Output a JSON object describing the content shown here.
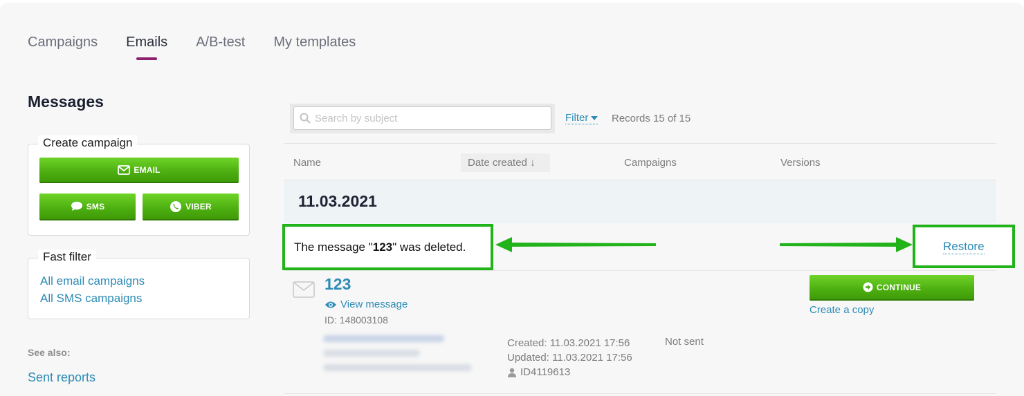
{
  "tabs": [
    "Campaigns",
    "Emails",
    "A/B-test",
    "My templates"
  ],
  "active_tab": "Emails",
  "sidebar": {
    "title": "Messages",
    "create_campaign": {
      "legend": "Create campaign",
      "email_label": "EMAIL",
      "sms_label": "SMS",
      "viber_label": "VIBER"
    },
    "fast_filter": {
      "legend": "Fast filter",
      "links": [
        "All email campaigns",
        "All SMS campaigns"
      ]
    },
    "see_also_label": "See also:",
    "sent_reports_label": "Sent reports"
  },
  "toolbar": {
    "search_placeholder": "Search by subject",
    "filter_label": "Filter",
    "records_text": "Records 15 of 15"
  },
  "table": {
    "headers": [
      "Name",
      "Date created",
      "Campaigns",
      "Versions"
    ],
    "date_created_sort_glyph": "↓",
    "date_group": "11.03.2021"
  },
  "notification": {
    "prefix": "The message \"",
    "name": "123",
    "suffix": "\" was deleted.",
    "restore_label": "Restore"
  },
  "message": {
    "title": "123",
    "view_label": "View message",
    "id_text": "ID: 148003108",
    "created": "Created: 11.03.2021 17:56",
    "updated": "Updated: 11.03.2021 17:56",
    "user_id": "ID4119613",
    "status": "Not sent",
    "continue_label": "CONTINUE",
    "copy_label": "Create a copy"
  },
  "colors": {
    "accent_tab": "#8e1f6f",
    "link": "#2d8bb5",
    "button_green": "#4cae10",
    "annotation_green": "#22b21a"
  }
}
